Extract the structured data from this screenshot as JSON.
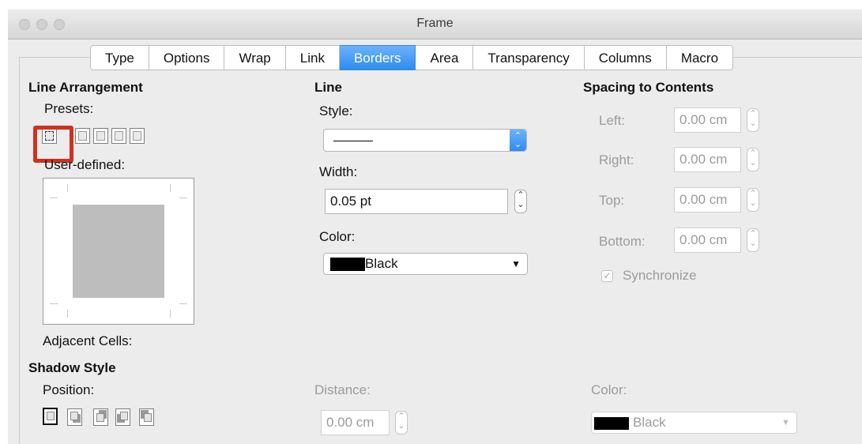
{
  "window": {
    "title": "Frame"
  },
  "tabs": [
    "Type",
    "Options",
    "Wrap",
    "Link",
    "Borders",
    "Area",
    "Transparency",
    "Columns",
    "Macro"
  ],
  "active_tab": "Borders",
  "line_arrangement": {
    "heading": "Line Arrangement",
    "presets_label": "Presets:",
    "user_defined_label": "User-defined:",
    "adjacent_cells_label": "Adjacent Cells:"
  },
  "line": {
    "heading": "Line",
    "style_label": "Style:",
    "width_label": "Width:",
    "width_value": "0.05 pt",
    "color_label": "Color:",
    "color_value": "Black"
  },
  "spacing": {
    "heading": "Spacing to Contents",
    "left_label": "Left:",
    "left_value": "0.00 cm",
    "right_label": "Right:",
    "right_value": "0.00 cm",
    "top_label": "Top:",
    "top_value": "0.00 cm",
    "bottom_label": "Bottom:",
    "bottom_value": "0.00 cm",
    "synchronize_label": "Synchronize"
  },
  "shadow": {
    "heading": "Shadow Style",
    "position_label": "Position:",
    "distance_label": "Distance:",
    "distance_value": "0.00 cm",
    "color_label": "Color:",
    "color_value": "Black"
  },
  "colors": {
    "accent": "#2d8cf0",
    "highlight": "#d0311f"
  }
}
